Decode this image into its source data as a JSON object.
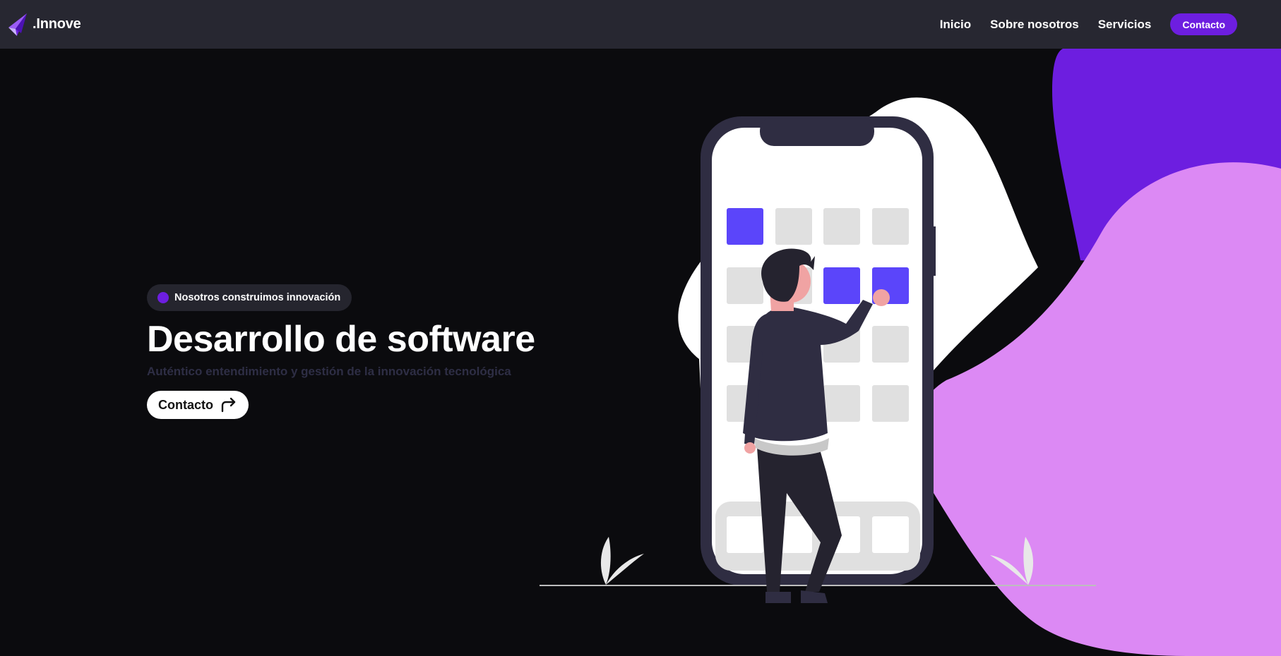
{
  "brand": {
    "name": ".Innove",
    "logo_icon": "paper-plane-logo"
  },
  "nav": {
    "links": [
      "Inicio",
      "Sobre nosotros",
      "Servicios"
    ],
    "cta_label": "Contacto"
  },
  "hero": {
    "badge": "Nosotros construimos innovación",
    "title": "Desarrollo de software",
    "subtitle": "Auténtico entendimiento y gestión de la innovación tecnológica",
    "cta_label": "Contacto",
    "cta_icon": "share-arrow-icon",
    "illustration": "person-tapping-app-grid-on-phone"
  },
  "colors": {
    "background": "#0b0b0e",
    "navbar": "#272731",
    "accent": "#6d1ee0",
    "blob_light": "#dc89f4",
    "tile_active": "#5b45fa",
    "tile_idle": "#e0e0e0",
    "phone_frame": "#2f2d42"
  }
}
